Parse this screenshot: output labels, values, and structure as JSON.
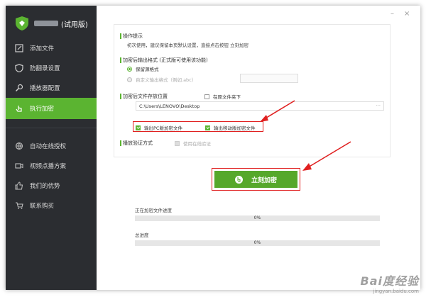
{
  "app": {
    "title_suffix": "(试用版)"
  },
  "sidebar": {
    "items": [
      {
        "label": "添加文件",
        "icon": "edit-icon"
      },
      {
        "label": "防翻录设置",
        "icon": "shield-icon"
      },
      {
        "label": "播放器配置",
        "icon": "search-icon"
      },
      {
        "label": "执行加密",
        "icon": "touch-icon"
      }
    ],
    "items2": [
      {
        "label": "自动在线授权",
        "icon": "globe-icon"
      },
      {
        "label": "视频点播方案",
        "icon": "video-icon"
      },
      {
        "label": "我们的优势",
        "icon": "thumbs-up-icon"
      },
      {
        "label": "联系购买",
        "icon": "cart-icon"
      }
    ],
    "active_color": "#5bb431"
  },
  "window_controls": {
    "minimize": "–",
    "close": "×"
  },
  "panel": {
    "tips_title": "操作提示",
    "tips_text": "初次使用，建议保留本页默认设置，直接点击按钮 立刻加密",
    "format_title": "加密后输出格式 (正式版可使用该功能)",
    "keep_format": "保留源格式",
    "custom_format": "自定义输出格式（例如.abc）",
    "path_title": "加密后文件存放位置",
    "in_source": "在原文件夹下",
    "path_value": "C:\\Users\\LENOVO\\Desktop",
    "browse": "···",
    "output_pc": "输出PC版加密文件",
    "output_mobile": "输出移动版加密文件",
    "verify_title": "播放验证方式",
    "online_verify": "使用在线验证"
  },
  "action": {
    "encrypt_label": "立刻加密"
  },
  "progress": {
    "current_label": "正在加密文件进度",
    "current_value": "0%",
    "total_label": "总进度",
    "total_value": "0%"
  },
  "watermark": {
    "line1": "Bai度经验",
    "line2": "jingyan.baidu.com"
  }
}
